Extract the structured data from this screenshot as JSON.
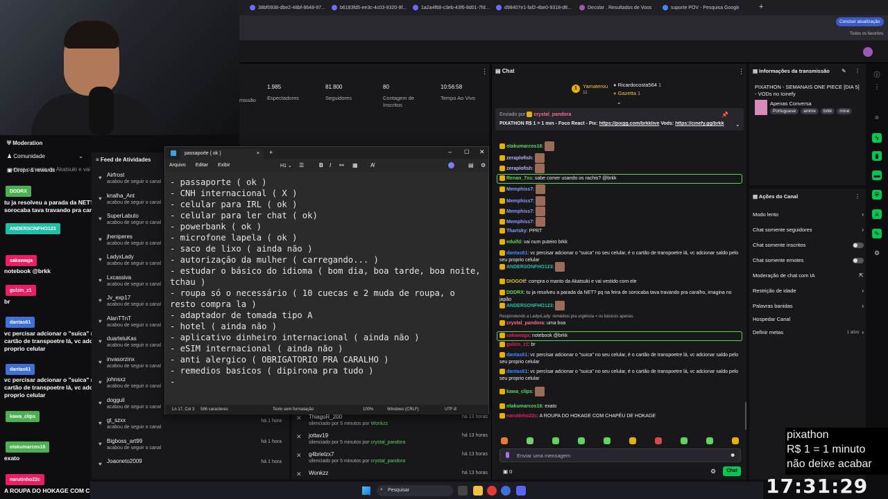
{
  "browser": {
    "tabs": [
      "38bf0938-dbe2-48bf-8648-97...",
      "b6183fd5-ee3c-4c03-9320-9f...",
      "1a2a4f68-c3eb-43f6-8d01-7fd...",
      "d98407e1-faf2-4be0-9318-d8...",
      "Decolar . Resultados de Voos",
      "suporte POV - Pesquisa Google"
    ],
    "update_button": "Concluir atualização",
    "bookmarks_label": "Todos os favoritos"
  },
  "overlay": {
    "moderation": "Moderation",
    "community": "Comunidade",
    "drops": "Drops & rewards",
    "overlay_chat_top": "compra o manto da Akatsuki e vai vestido com ele",
    "messages": [
      {
        "user": "DDDRX",
        "color": "#4caf50",
        "text": "tu ja resolveu a parada da NET? pq na feira de sorocaba tava travando pra caralho, imagina no japão"
      },
      {
        "user": "ANDERSONFHO123",
        "color": "#1fbfa6",
        "text": ""
      },
      {
        "user": "sakawaga",
        "color": "#e91e63",
        "text": "notebook @brkk"
      },
      {
        "user": "gulzin_z1",
        "color": "#e91e63",
        "text": "br"
      },
      {
        "user": "dantas61",
        "color": "#3f6fd8",
        "text": "vc percisar adcionar o \"suica\" no seu celular, é o cartão de transpoetre lá, vc adcionar saldo pelo seu proprio celular"
      },
      {
        "user": "dantas61",
        "color": "#3f6fd8",
        "text": "vc percisar adcionar o \"suica\" no seu celular, é o cartão de transpoetre lá, vc adcionar saldo pelo seu proprio celular"
      },
      {
        "user": "kawa_clips",
        "color": "#4caf50",
        "text": ""
      },
      {
        "user": "otakumarcos16",
        "color": "#4caf50",
        "text": "exato"
      },
      {
        "user": "narutinho22c",
        "color": "#e91e63",
        "text": "A ROUPA DO HOKAGE COM CHAPÉU DE HOKAGE"
      }
    ]
  },
  "stats": [
    {
      "value": "1.985",
      "label": "Espectadores"
    },
    {
      "value": "81.800",
      "label": "Seguidores"
    },
    {
      "value": "80",
      "label": "Contagem de Inscritos"
    },
    {
      "value": "10:56:58",
      "label": "Tempo Ao Vivo"
    }
  ],
  "stats_partial_label": "missão",
  "feed": {
    "title": "Feed de Atividades",
    "items": [
      {
        "name": "Airfrost",
        "sub": "acabou de seguir o canal"
      },
      {
        "name": "knalha_Ant",
        "sub": "acabou de seguir o canal"
      },
      {
        "name": "SuperLabuto",
        "sub": "acabou de seguir o canal"
      },
      {
        "name": "jheniperes",
        "sub": "acabou de seguir o canal"
      },
      {
        "name": "LadyxLady",
        "sub": "acabou de seguir o canal"
      },
      {
        "name": "Lxcassiva",
        "sub": "acabou de seguir o canal"
      },
      {
        "name": "Jv_exp17",
        "sub": "acabou de seguir o canal"
      },
      {
        "name": "AlanTTnT",
        "sub": "acabou de seguir o canal"
      },
      {
        "name": "duarteluKas",
        "sub": "acabou de seguir o canal"
      },
      {
        "name": "invasorzinx",
        "sub": "acabou de seguir o canal"
      },
      {
        "name": "johnsxz",
        "sub": "acabou de seguir o canal"
      },
      {
        "name": "dogguli",
        "sub": "acabou de seguir o canal",
        "time": "há 1 hora"
      },
      {
        "name": "gt_szxx",
        "sub": "acabou de seguir o canal",
        "time": "há 1 hora"
      },
      {
        "name": "Bigboss_art99",
        "sub": "acabou de seguir o canal",
        "time": "há 1 hora"
      },
      {
        "name": "Joaoneto2009",
        "sub": "",
        "time": "há 1 hora"
      }
    ]
  },
  "mods": [
    {
      "name": "ThiagoR_200",
      "sub": "silenciado por 5 minutos por",
      "by": "Wonkzz",
      "time": "há 13 horas"
    },
    {
      "name": "jottav19",
      "sub": "silenciado por 5 minutos por",
      "by": "crystal_pandora",
      "time": "há 13 horas"
    },
    {
      "name": "g4brielzx7",
      "sub": "silenciado por 5 minutos por",
      "by": "crystal_pandora",
      "time": "há 13 horas"
    },
    {
      "name": "Wonkzz",
      "sub": "",
      "by": "",
      "time": "há 13 horas"
    }
  ],
  "notepad": {
    "tab_title": "passaporte ( ok )",
    "menu": [
      "Arquivo",
      "Editar",
      "Exibir"
    ],
    "heading": "H1",
    "lines": [
      "- passaporte ( ok )",
      "- CNH internacional ( X )",
      "- celular para IRL ( ok )",
      "- celular para ler chat ( ok)",
      "- powerbank ( ok )",
      "- microfone lapela ( ok )",
      "- saco de lixo ( ainda não )",
      "- autorização da mulher ( carregando... )",
      "- estudar o básico do idioma ( bom dia, boa tarde, boa noite,",
      "tchau )",
      "- roupa só o necessário ( 10 cuecas e 2 muda de roupa, o",
      "resto compra la )",
      "- adaptador de tomada tipo A",
      "- hotel ( ainda não )",
      "- aplicativo dinheiro internacional ( ainda não )",
      "- eSIM internacional ( ainda não )",
      "- anti alergico ( OBRIGATORIO PRA CARALHO )",
      "- remedios basicos ( dipirona pra tudo )",
      "-"
    ],
    "status": {
      "pos": "Ln 17, Col 3",
      "chars": "586 caracteres",
      "format": "Texto sem formatação",
      "zoom": "100%",
      "eol": "Windows (CRLF)",
      "enc": "UTF-8"
    }
  },
  "chat": {
    "title": "Chat",
    "leader1": "Yamaterou",
    "leader1_sub": "11",
    "leader2": "Ricardocosta564",
    "leader2_val": "1",
    "leader3": "Gazetta",
    "leader3_val": "1",
    "pinned_by_label": "Enviado por",
    "pinned_by": "crystal_pandora",
    "pinned_text": "PIXATHON R$ 1 = 1 min - Foco React - Pix:",
    "pinned_link1": "https://pixgg.com/brkklive",
    "pinned_vods": "Vods:",
    "pinned_link2": "https://cinefy.gg/brkk",
    "messages": [
      {
        "u": "zeraplofish",
        "c": "#b5b5ff",
        "t": ""
      },
      {
        "u": "otakumarcos16",
        "c": "#5cd65c",
        "t": ""
      },
      {
        "u": "zeraplofish",
        "c": "#b5b5ff",
        "t": ""
      },
      {
        "u": "zeraplofish",
        "c": "#b5b5ff",
        "t": ""
      },
      {
        "u": "Renan_7xs",
        "c": "#5cd65c",
        "t": "sabe comer usando os rachis? @brkk"
      },
      {
        "u": "Memphiss7",
        "c": "#8a9cff",
        "t": ""
      },
      {
        "u": "Memphiss7",
        "c": "#8a9cff",
        "t": ""
      },
      {
        "u": "Memphiss7",
        "c": "#8a9cff",
        "t": ""
      },
      {
        "u": "Memphiss7",
        "c": "#8a9cff",
        "t": ""
      },
      {
        "u": "Tharisky",
        "c": "#8a9cff",
        "t": "PPRT"
      },
      {
        "u": "eduifd",
        "c": "#5cd65c",
        "t": "vai num puteiro brkk"
      },
      {
        "u": "dantas61",
        "c": "#3f8cff",
        "t": "vc percisar adcionar o \"suica\" no seu celular, é o cartão de transpoetre lá, vc adcionar saldo pelo seu proprio celular"
      },
      {
        "u": "ANDERSONFHO123",
        "c": "#1fbfa6",
        "t": ""
      },
      {
        "u": "DIOGOtf",
        "c": "#e0c040",
        "t": "compra o manto da Akatsuki e vai vestido com ele"
      },
      {
        "u": "DDDRX",
        "c": "#5cd65c",
        "t": "tu ja resolveu a parada da NET? pq na feira de sorocaba tava travando pra caralho, imagina no japão"
      },
      {
        "u": "ANDERSONFHO123",
        "c": "#1fbfa6",
        "t": ""
      },
      {
        "u": "crystal_pandora",
        "c": "#ff6b8a",
        "t": "uma boa",
        "reply": "Respondendo a LadyxLady: remédios pra urgência = os básicos apenas"
      },
      {
        "u": "sakawaga",
        "c": "#e91e63",
        "t": "notebook @brkk"
      },
      {
        "u": "gulzin_z1",
        "c": "#e91e63",
        "t": "br"
      },
      {
        "u": "dantas61",
        "c": "#3f8cff",
        "t": "vc percisar adcionar o \"suica\" no seu celular, é o cartão de transpoetre lá, vc adcionar saldo pelo seu proprio celular"
      },
      {
        "u": "dantas61",
        "c": "#3f8cff",
        "t": "vc percisar adcionar o \"suica\" no seu celular, é o cartão de transpoetre lá, vc adcionar saldo pelo seu proprio celular"
      },
      {
        "u": "kawa_clips",
        "c": "#5cd65c",
        "t": ""
      },
      {
        "u": "otakumarcos16",
        "c": "#5cd65c",
        "t": "exato"
      },
      {
        "u": "narutinho22c",
        "c": "#e91e63",
        "t": "A ROUPA DO HOKAGE COM CHAPÉU DE HOKAGE"
      }
    ],
    "input_placeholder": "Enviar uma mensagem",
    "points": "0",
    "send": "Chat"
  },
  "info": {
    "title": "Informações da transmissão",
    "stream_title": "PIXATHON - SEMANAIS ONE PIECE [DIA 5] - VODs no Icinefy",
    "category": "Apenas Conversa",
    "tags": [
      "Portuguese",
      "anime",
      "brkk",
      "mine"
    ]
  },
  "actions": {
    "title": "Ações do Canal",
    "items": [
      {
        "label": "Modo lento",
        "kind": "chev"
      },
      {
        "label": "Chat somente seguidores",
        "kind": "chev"
      },
      {
        "label": "Chat somente inscritos",
        "kind": "toggle"
      },
      {
        "label": "Chat somente emotes",
        "kind": "toggle"
      },
      {
        "label": "Moderação de chat com IA",
        "kind": "ext"
      },
      {
        "label": "Restrição de idade",
        "kind": "chev"
      },
      {
        "label": "Palavras banidas",
        "kind": "chev"
      },
      {
        "label": "Hospedar Canal",
        "kind": "none"
      },
      {
        "label": "Definir metas",
        "kind": "chev",
        "extra": "1 ativo"
      }
    ]
  },
  "pixathon": {
    "l1": "pixathon",
    "l2": "R$ 1 = 1 minuto",
    "l3": "não deixe acabar",
    "timer": "17:31:29"
  },
  "taskbar": {
    "search": "Pesquisar"
  }
}
